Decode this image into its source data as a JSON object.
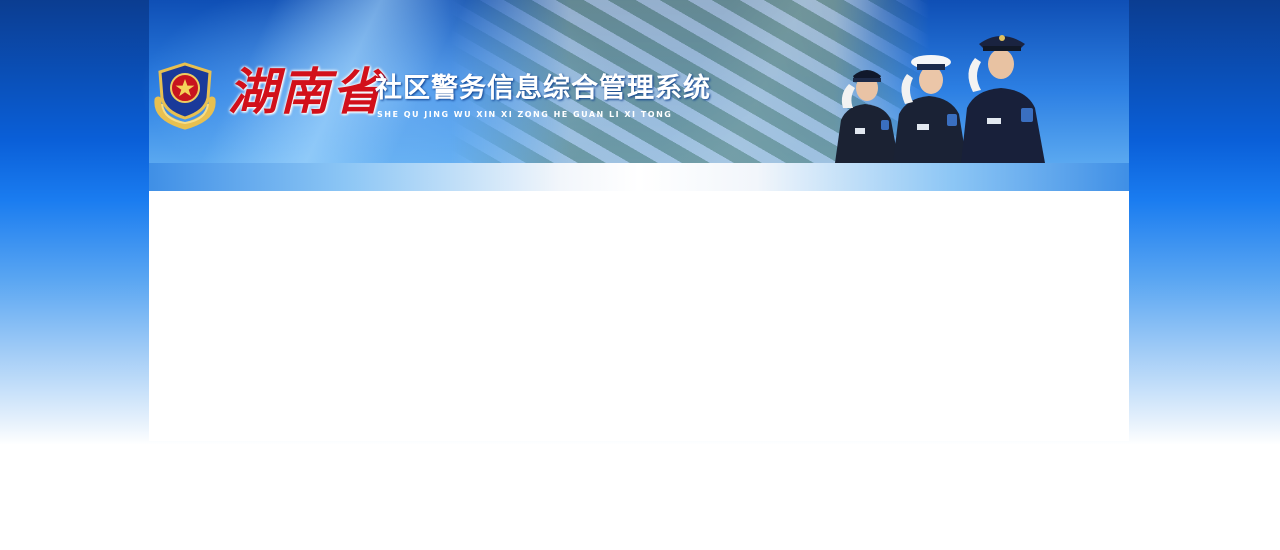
{
  "header": {
    "province": "湖南省",
    "system_title": "社区警务信息综合管理系统",
    "system_pinyin": "SHE QU JING WU XIN XI ZONG HE GUAN LI XI TONG"
  },
  "icons": {
    "emblem": "police-emblem-icon",
    "officers": "saluting-officers-illustration"
  },
  "colors": {
    "brand_red": "#d2101a",
    "banner_blue": "#0a5fd8",
    "title_white": "#ffffff"
  }
}
